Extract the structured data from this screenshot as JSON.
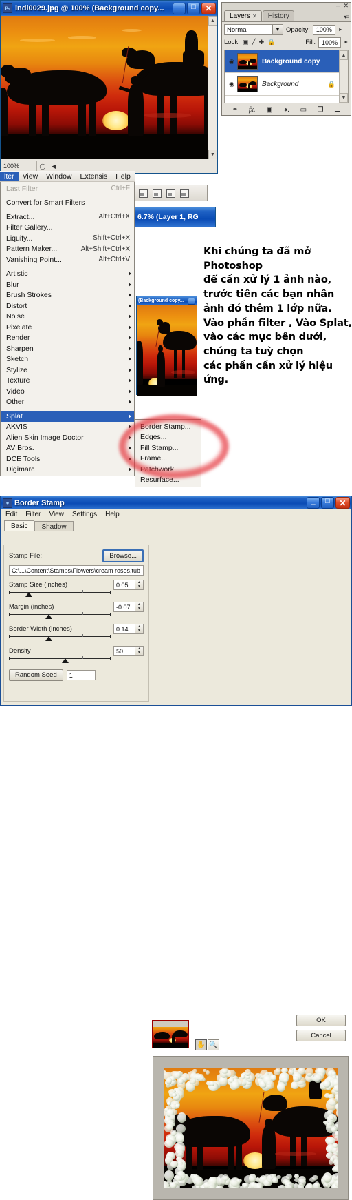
{
  "doc_window": {
    "title": "indi0029.jpg @ 100% (Background copy...",
    "minimize": "_",
    "maximize": "□",
    "close": "✕",
    "zoom_level": "100%",
    "scroll_up": "▲",
    "scroll_down": "▼",
    "status_nav": "◀"
  },
  "layers_panel": {
    "minimize": "–",
    "close": "✕",
    "menu": "▾≡",
    "tabs": [
      {
        "label": "Layers",
        "close": "✕",
        "active": true
      },
      {
        "label": "History",
        "close": "",
        "active": false
      }
    ],
    "blend_mode": "Normal",
    "opacity_label": "Opacity:",
    "opacity_value": "100%",
    "lock_label": "Lock:",
    "fill_label": "Fill:",
    "fill_value": "100%",
    "lock_icons": [
      "transparency-lock",
      "brush-lock",
      "move-lock",
      "all-lock"
    ],
    "layers": [
      {
        "name": "Background copy",
        "selected": true,
        "locked": false,
        "eye": "◉"
      },
      {
        "name": "Background",
        "selected": false,
        "locked": true,
        "eye": "◉",
        "lock_glyph": "🔒"
      }
    ],
    "footer_icons": [
      "link-icon",
      "fx-icon",
      "mask-icon",
      "adjustment-icon",
      "group-icon",
      "new-layer-icon",
      "trash-icon"
    ],
    "footer_glyphs": [
      "⚭",
      "fx.",
      "▣",
      "◑.",
      "▭",
      "❐",
      "～"
    ]
  },
  "options_bar": {
    "align_icons": [
      "align-left-icon",
      "align-center-icon",
      "align-right-icon",
      "distribute-icon"
    ]
  },
  "doc2": {
    "title": "6.7% (Layer 1, RG"
  },
  "mini_doc": {
    "title": "(Background copy...",
    "minimize": "_"
  },
  "filter_menu": {
    "menubar": [
      {
        "label": "lter",
        "active": true
      },
      {
        "label": "View",
        "active": false
      },
      {
        "label": "Window",
        "active": false
      },
      {
        "label": "Extensis",
        "active": false
      },
      {
        "label": "Help",
        "active": false
      }
    ],
    "items": [
      {
        "label": "Last Filter",
        "shortcut": "Ctrl+F",
        "disabled": true,
        "submenu": false
      },
      {
        "sep": true
      },
      {
        "label": "Convert for Smart Filters",
        "shortcut": "",
        "submenu": false
      },
      {
        "sep": true
      },
      {
        "label": "Extract...",
        "shortcut": "Alt+Ctrl+X",
        "submenu": false
      },
      {
        "label": "Filter Gallery...",
        "shortcut": "",
        "submenu": false
      },
      {
        "label": "Liquify...",
        "shortcut": "Shift+Ctrl+X",
        "submenu": false
      },
      {
        "label": "Pattern Maker...",
        "shortcut": "Alt+Shift+Ctrl+X",
        "submenu": false
      },
      {
        "label": "Vanishing Point...",
        "shortcut": "Alt+Ctrl+V",
        "submenu": false
      },
      {
        "sep": true
      },
      {
        "label": "Artistic",
        "shortcut": "",
        "submenu": true
      },
      {
        "label": "Blur",
        "shortcut": "",
        "submenu": true
      },
      {
        "label": "Brush Strokes",
        "shortcut": "",
        "submenu": true
      },
      {
        "label": "Distort",
        "shortcut": "",
        "submenu": true
      },
      {
        "label": "Noise",
        "shortcut": "",
        "submenu": true
      },
      {
        "label": "Pixelate",
        "shortcut": "",
        "submenu": true
      },
      {
        "label": "Render",
        "shortcut": "",
        "submenu": true
      },
      {
        "label": "Sharpen",
        "shortcut": "",
        "submenu": true
      },
      {
        "label": "Sketch",
        "shortcut": "",
        "submenu": true
      },
      {
        "label": "Stylize",
        "shortcut": "",
        "submenu": true
      },
      {
        "label": "Texture",
        "shortcut": "",
        "submenu": true
      },
      {
        "label": "Video",
        "shortcut": "",
        "submenu": true
      },
      {
        "label": "Other",
        "shortcut": "",
        "submenu": true
      },
      {
        "sep": true
      },
      {
        "label": "Splat",
        "shortcut": "",
        "submenu": true,
        "highlight": true
      },
      {
        "label": "AKVIS",
        "shortcut": "",
        "submenu": true
      },
      {
        "label": "Alien Skin Image Doctor",
        "shortcut": "",
        "submenu": true
      },
      {
        "label": "AV Bros.",
        "shortcut": "",
        "submenu": true
      },
      {
        "label": "DCE Tools",
        "shortcut": "",
        "submenu": true
      },
      {
        "label": "Digimarc",
        "shortcut": "",
        "submenu": true
      }
    ],
    "splat_submenu": [
      {
        "label": "Border Stamp..."
      },
      {
        "label": "Edges..."
      },
      {
        "label": "Fill Stamp..."
      },
      {
        "label": "Frame..."
      },
      {
        "label": "Patchwork..."
      },
      {
        "label": "Resurface..."
      }
    ]
  },
  "annotation": {
    "circle_color": "#e42830"
  },
  "vietnamese_text": {
    "lines": [
      "Khi chúng ta đã mở Photoshop",
      "để cần xử lý 1 ảnh nào,",
      " trước tiên các bạn nhân",
      "ảnh đó thêm  1 lớp nữa.",
      "Vào phần filter , Vào Splat,",
      " vào các mục bên dưới,",
      "chúng ta tuỳ chọn",
      "các phần cần xử lý hiệu ứng."
    ]
  },
  "border_stamp_dialog": {
    "title": "Border Stamp",
    "minimize": "_",
    "maximize": "□",
    "close": "✕",
    "menubar": [
      "Edit",
      "Filter",
      "View",
      "Settings",
      "Help"
    ],
    "tabs": [
      {
        "label": "Basic",
        "active": true
      },
      {
        "label": "Shadow",
        "active": false
      }
    ],
    "stamp_file_label": "Stamp File:",
    "browse_button": "Browse...",
    "stamp_file_path": "C:\\...\\Content\\Stamps\\Flowers\\cream roses.tub",
    "sliders": [
      {
        "label": "Stamp Size (inches)",
        "value": "0.05",
        "thumb_pct": 16
      },
      {
        "label": "Margin (inches)",
        "value": "-0.07",
        "thumb_pct": 36
      },
      {
        "label": "Border Width (inches)",
        "value": "0.14",
        "thumb_pct": 36
      },
      {
        "label": "Density",
        "value": "50",
        "thumb_pct": 52
      }
    ],
    "random_seed_button": "Random Seed",
    "random_seed_value": "1",
    "ok_button": "OK",
    "cancel_button": "Cancel",
    "tools": [
      {
        "name": "hand-tool",
        "glyph": "✋",
        "pressed": true
      },
      {
        "name": "zoom-tool",
        "glyph": "🔍",
        "pressed": false
      }
    ]
  }
}
